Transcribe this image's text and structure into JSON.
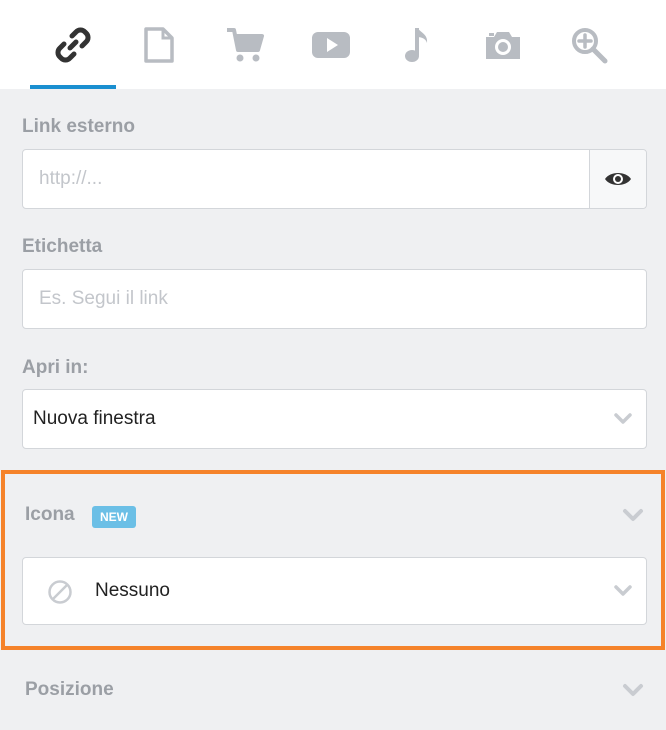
{
  "tabs": [
    {
      "icon": "link-icon",
      "active": true
    },
    {
      "icon": "page-icon",
      "active": false
    },
    {
      "icon": "cart-icon",
      "active": false
    },
    {
      "icon": "video-icon",
      "active": false
    },
    {
      "icon": "music-icon",
      "active": false
    },
    {
      "icon": "camera-icon",
      "active": false
    },
    {
      "icon": "zoom-icon",
      "active": false
    }
  ],
  "link": {
    "label": "Link esterno",
    "placeholder": "http://..."
  },
  "etichetta": {
    "label": "Etichetta",
    "placeholder": "Es. Segui il link"
  },
  "apri": {
    "label": "Apri in:",
    "value": "Nuova finestra"
  },
  "icona": {
    "label": "Icona",
    "badge": "NEW",
    "value": "Nessuno"
  },
  "posizione": {
    "label": "Posizione"
  },
  "colors": {
    "accent": "#1a8fd0",
    "highlight": "#f5832b",
    "badge": "#6bbfe6",
    "icon": "#b8bcc2"
  }
}
